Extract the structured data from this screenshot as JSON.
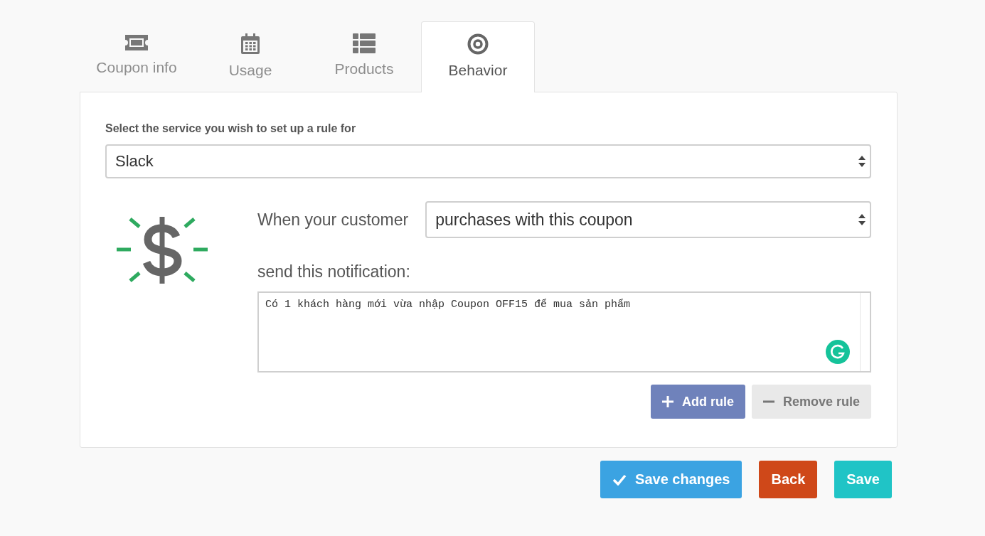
{
  "tabs": [
    {
      "label": "Coupon info",
      "selected": false
    },
    {
      "label": "Usage",
      "selected": false
    },
    {
      "label": "Products",
      "selected": false
    },
    {
      "label": "Behavior",
      "selected": true
    }
  ],
  "service": {
    "label": "Select the service you wish to set up a rule for",
    "value": "Slack"
  },
  "rule": {
    "trigger_label": "When your customer",
    "trigger_value": "purchases with this coupon",
    "notification_label": "send this notification:",
    "notification_value": "Có 1 khách hàng mới vừa nhập Coupon OFF15 để mua sản phẩm"
  },
  "rule_buttons": [
    {
      "label": "Add rule",
      "kind": "add"
    },
    {
      "label": "Remove rule",
      "kind": "remove"
    }
  ],
  "footer_buttons": [
    {
      "label": "Save changes",
      "kind": "confirm"
    },
    {
      "label": "Back",
      "kind": "back"
    },
    {
      "label": "Save",
      "kind": "save"
    }
  ]
}
